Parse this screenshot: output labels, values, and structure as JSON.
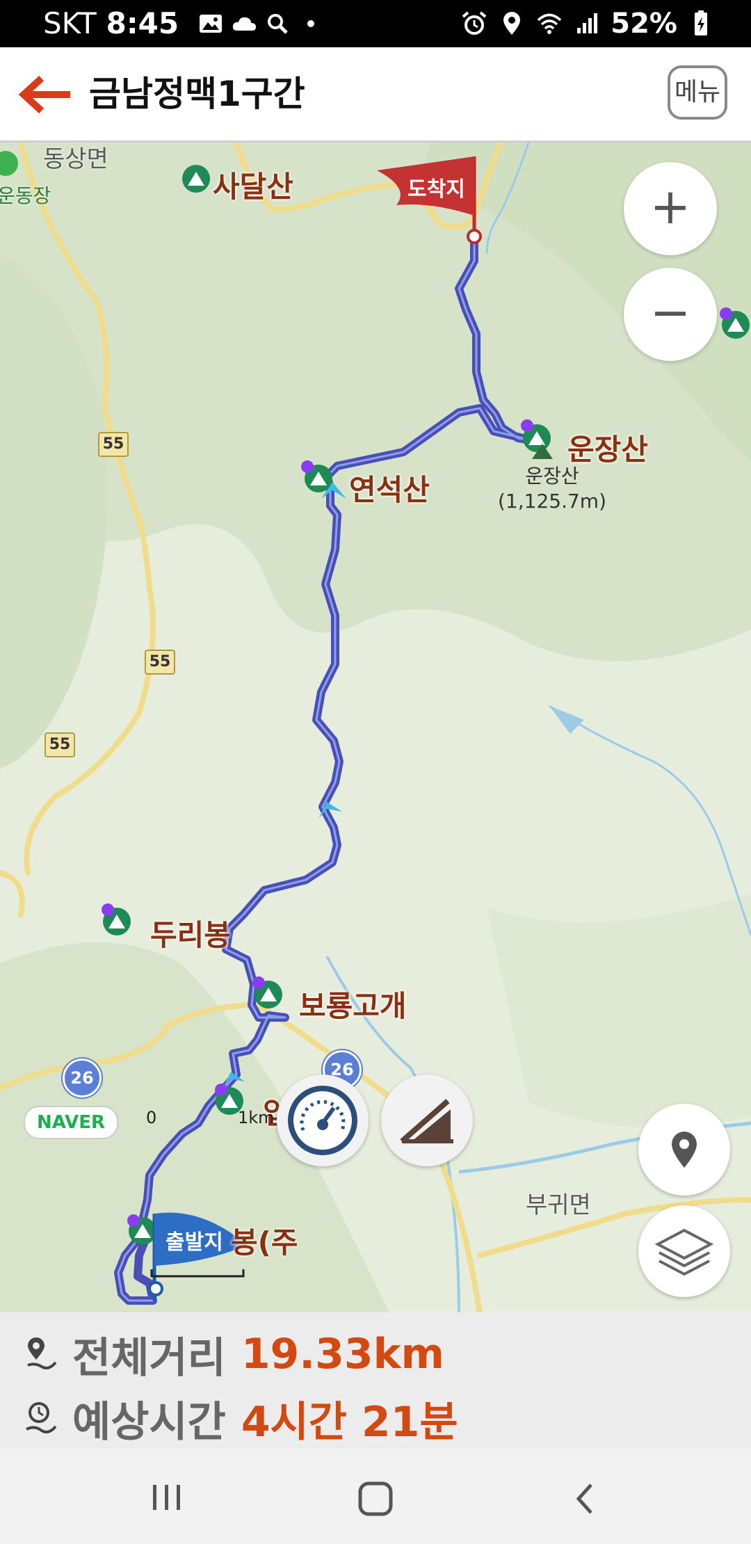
{
  "status_bar": {
    "carrier": "SKT",
    "time": "8:45",
    "battery": "52%",
    "left_icons": [
      "image-icon",
      "cloud-icon",
      "search-icon",
      "dot-icon"
    ],
    "right_icons": [
      "alarm-icon",
      "location-icon",
      "wifi-icon",
      "signal-icon",
      "battery-icon"
    ]
  },
  "header": {
    "back_icon": "arrow-left-icon",
    "title": "금남정맥1구간",
    "menu_label": "메뉴",
    "accent": "#d93a1a"
  },
  "map": {
    "peaks": [
      {
        "id": "sadalsan",
        "name": "사달산"
      },
      {
        "id": "unjangsan",
        "name": "운장산"
      },
      {
        "id": "yeonseoksan",
        "name": "연석산"
      },
      {
        "id": "duribong",
        "name": "두리봉"
      },
      {
        "id": "boryonggogae",
        "name": "보룡고개"
      },
      {
        "id": "ipbong",
        "name": "입봉"
      },
      {
        "id": "start-peak",
        "name": "봉(주"
      }
    ],
    "area_labels": [
      "동상면",
      "운동장",
      "부귀면"
    ],
    "summit_marker": {
      "name": "운장산",
      "elevation": "(1,125.7m)"
    },
    "road_shields": [
      "55",
      "55",
      "55"
    ],
    "national_routes": [
      "26",
      "26"
    ],
    "finish_flag": "도착지",
    "start_flag": "출발지",
    "naver_logo": "NAVER",
    "scale": {
      "zero": "0",
      "label": "1km"
    },
    "route_color": "#4a4fb8",
    "zoom_in": "+",
    "zoom_out": "−"
  },
  "buttons": {
    "speed_icon": "speedometer-icon",
    "elevation_icon": "elevation-profile-icon",
    "location_icon": "location-pin-icon",
    "layers_icon": "layers-icon"
  },
  "summary": {
    "distance_label": "전체거리",
    "distance_value": "19.33km",
    "time_label": "예상시간",
    "time_value": "4시간 21분"
  },
  "nav": {
    "recent_icon": "recent-apps-icon",
    "home_icon": "home-icon",
    "back_icon": "back-icon"
  }
}
